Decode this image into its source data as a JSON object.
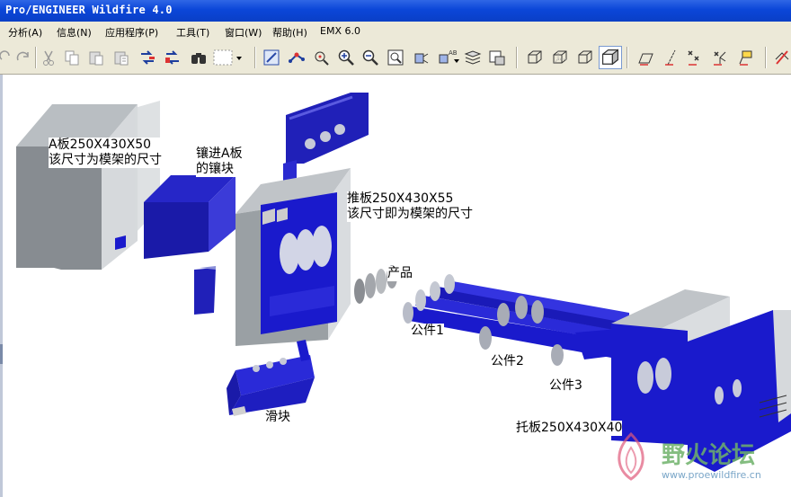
{
  "window": {
    "title": "Pro/ENGINEER Wildfire 4.0"
  },
  "menu": {
    "items": [
      "分析(A)",
      "信息(N)",
      "应用程序(P)",
      "工具(T)",
      "窗口(W)",
      "帮助(H)",
      "EMX 6.0"
    ]
  },
  "toolbar": {
    "icons": [
      "redo-icon",
      "cut-icon",
      "copy-icon",
      "paste-icon",
      "paste-special-icon",
      "regenerate-icon",
      "regen-manager-icon",
      "find-icon",
      "selection-filter-icon",
      "repaint-icon",
      "spin-center-icon",
      "orient-icon",
      "zoom-in-icon",
      "zoom-out-icon",
      "refit-icon",
      "view-manager-icon",
      "saved-views-icon",
      "layers-icon",
      "model-display-icon",
      "wireframe-icon",
      "hidden-line-icon",
      "no-hidden-icon",
      "shading-icon",
      "datum-planes-icon",
      "datum-axes-icon",
      "datum-points-icon",
      "coordinate-systems-icon",
      "annotations-icon",
      "spin-icon"
    ]
  },
  "annotations": {
    "a_plate": [
      "A板250X430X50",
      "该尺寸为模架的尺寸"
    ],
    "insert": [
      "镶进A板",
      "的镶块"
    ],
    "push_plate": [
      "推板250X430X55",
      "该尺寸即为模架的尺寸"
    ],
    "product": "产品",
    "part1": "公件1",
    "part2": "公件2",
    "part3": "公件3",
    "slider": "滑块",
    "support_plate": "托板250X430X40"
  },
  "watermark": {
    "title": "野火论坛",
    "url": "www.proewildfire.cn"
  },
  "colors": {
    "part_blue": "#1a1acc",
    "plate_gray": "#8c9196",
    "titlebar": "#0b46d8"
  }
}
